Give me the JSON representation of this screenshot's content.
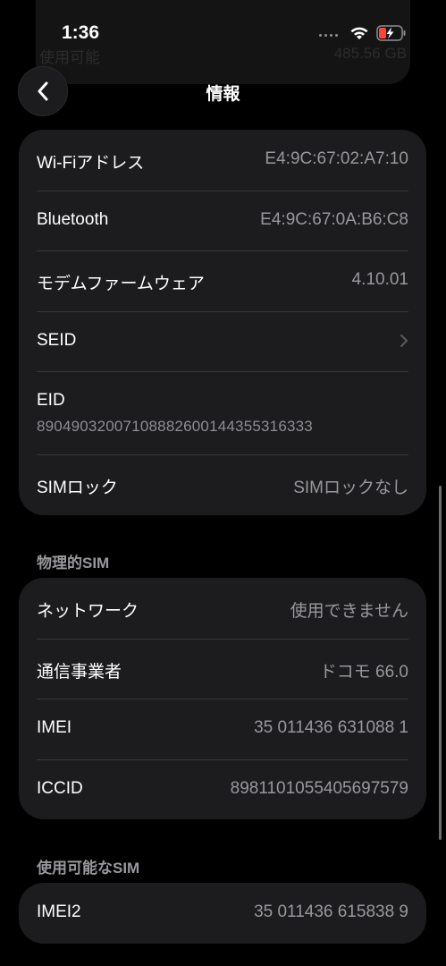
{
  "status": {
    "time": "1:36"
  },
  "ghost": {
    "label": "使用可能",
    "value": "485.56 GB"
  },
  "nav": {
    "title": "情報"
  },
  "card1": [
    {
      "label": "Wi-Fiアドレス",
      "value": "E4:9C:67:02:A7:10"
    },
    {
      "label": "Bluetooth",
      "value": "E4:9C:67:0A:B6:C8"
    },
    {
      "label": "モデムファームウェア",
      "value": "4.10.01"
    },
    {
      "label": "SEID",
      "value": ""
    },
    {
      "label": "EID",
      "value": "89049032007108882600144355316333"
    },
    {
      "label": "SIMロック",
      "value": "SIMロックなし"
    }
  ],
  "section_physical": "物理的SIM",
  "card2": [
    {
      "label": "ネットワーク",
      "value": "使用できません"
    },
    {
      "label": "通信事業者",
      "value": "ドコモ 66.0"
    },
    {
      "label": "IMEI",
      "value": "35 011436 631088 1"
    },
    {
      "label": "ICCID",
      "value": "8981101055405697579"
    }
  ],
  "section_available": "使用可能なSIM",
  "card3": [
    {
      "label": "IMEI2",
      "value": "35 011436 615838 9"
    }
  ]
}
